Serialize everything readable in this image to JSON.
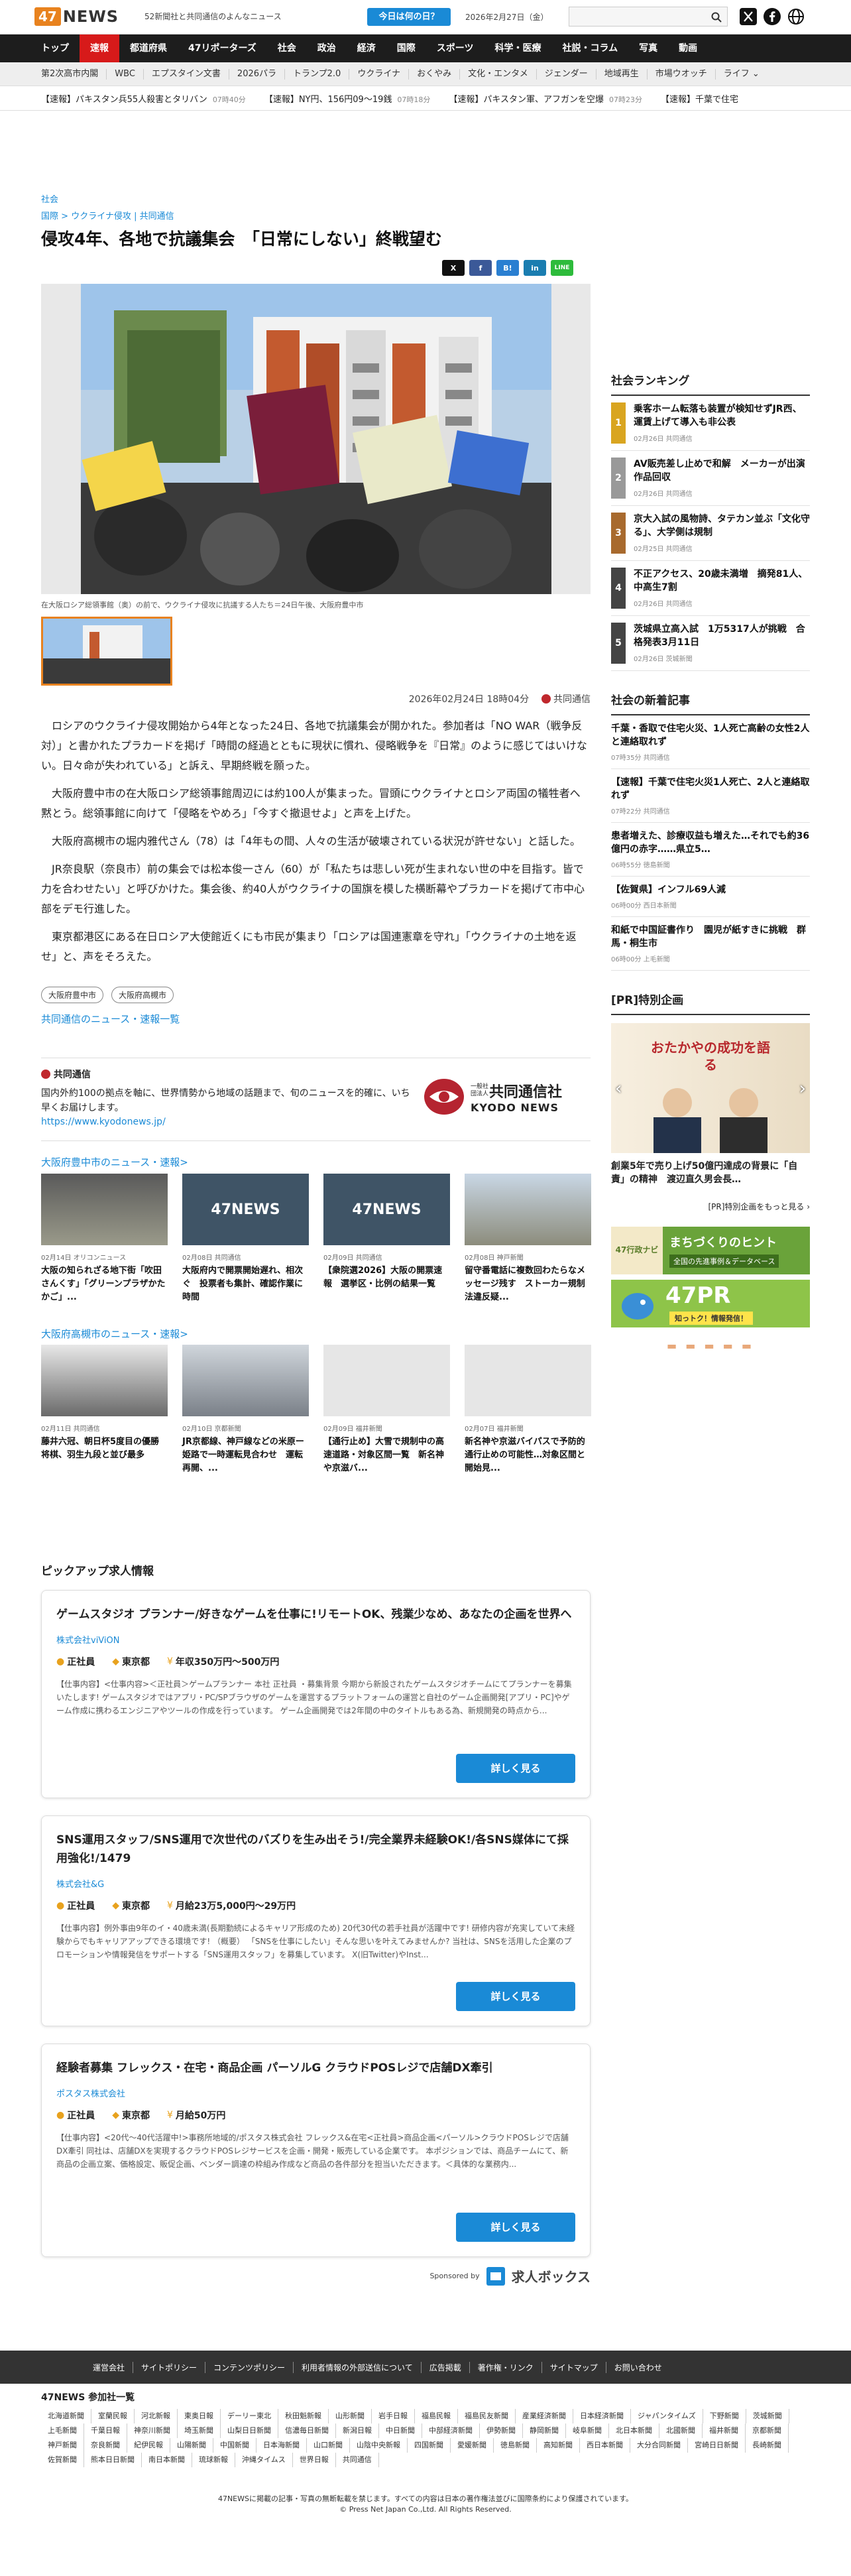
{
  "header": {
    "logo_num": "47",
    "logo_text": "NEWS",
    "tagline": "52新聞社と共同通信のよんなニュース",
    "today_button": "今日は何の日？",
    "date": "2026年2月27日（金）"
  },
  "nav": [
    "トップ",
    "速報",
    "都道府県",
    "47リポーターズ",
    "社会",
    "政治",
    "経済",
    "国際",
    "スポーツ",
    "科学・医療",
    "社説・コラム",
    "写真",
    "動画"
  ],
  "subnav": [
    "第2次高市内閣",
    "WBC",
    "エプスタイン文書",
    "2026パラ",
    "トランプ2.0",
    "ウクライナ",
    "おくやみ",
    "文化・エンタメ",
    "ジェンダー",
    "地域再生",
    "市場ウオッチ",
    "ライフ"
  ],
  "ticker": [
    {
      "text": "【速報】パキスタン兵55人殺害とタリバン",
      "time": "07時40分"
    },
    {
      "text": "【速報】NY円、156円09～19銭",
      "time": "07時18分"
    },
    {
      "text": "【速報】パキスタン軍、アフガンを空爆",
      "time": "07時23分"
    },
    {
      "text": "【速報】千葉で住宅",
      "time": ""
    }
  ],
  "article": {
    "category": "社会",
    "breadcrumb": [
      "国際",
      "ウクライナ侵攻",
      "共同通信"
    ],
    "headline": "侵攻4年、各地で抗議集会　「日常にしない」終戦望む",
    "caption": "在大阪ロシア総領事館（奥）の前で、ウクライナ侵攻に抗議する人たち＝24日午後、大阪府豊中市",
    "published": "2026年02月24日 18時04分",
    "source": "共同通信",
    "paragraphs": [
      "ロシアのウクライナ侵攻開始から4年となった24日、各地で抗議集会が開かれた。参加者は「NO WAR（戦争反対）」と書かれたプラカードを掲げ「時間の経過とともに現状に慣れ、侵略戦争を『日常』のように感じてはいけない。日々命が失われている」と訴え、早期終戦を願った。",
      "大阪府豊中市の在大阪ロシア総領事館周辺には約100人が集まった。冒頭にウクライナとロシア両国の犠牲者へ黙とう。総領事館に向けて「侵略をやめろ」「今すぐ撤退せよ」と声を上げた。",
      "大阪府高槻市の堀内雅代さん（78）は「4年もの間、人々の生活が破壊されている状況が許せない」と話した。",
      "JR奈良駅（奈良市）前の集会では松本俊一さん（60）が「私たちは悲しい死が生まれない世の中を目指す。皆で力を合わせたい」と呼びかけた。集会後、約40人がウクライナの国旗を模した横断幕やプラカードを掲げて市中心部をデモ行進した。",
      "東京都港区にある在日ロシア大使館近くにも市民が集まり「ロシアは国連憲章を守れ」「ウクライナの土地を返せ」と、声をそろえた。"
    ],
    "tags": [
      "大阪府豊中市",
      "大阪府高槻市"
    ],
    "more_link": "共同通信のニュース・速報一覧"
  },
  "share": [
    "X",
    "f",
    "B!",
    "in",
    "LINE"
  ],
  "kyodo": {
    "title": "共同通信",
    "description": "国内外約100の拠点を軸に、世界情勢から地域の話題まで、旬のニュースを的確に、いち早くお届けします。",
    "url": "https://www.kyodonews.jp/",
    "logo_sub": "一般社団法人",
    "logo_name": "共同通信社",
    "logo_en": "KYODO NEWS"
  },
  "toyonaka": {
    "title": "大阪府豊中市のニュース・速報>",
    "cards": [
      {
        "date": "02月14日",
        "source": "オリコンニュース",
        "title": "大阪の知られざる地下街「吹田さんくす」「グリーンプラザかたかご」..."
      },
      {
        "date": "02月08日",
        "source": "共同通信",
        "title": "大阪府内で開票開始遅れ、相次ぐ　投票者も集計、確認作業に時間"
      },
      {
        "date": "02月09日",
        "source": "共同通信",
        "title": "【衆院選2026】大阪の開票速報　選挙区・比例の結果一覧"
      },
      {
        "date": "02月08日",
        "source": "神戸新聞",
        "title": "留守番電話に複数回わたらなメッセージ残す　ストーカー規制法違反疑..."
      }
    ]
  },
  "takatsuki": {
    "title": "大阪府高槻市のニュース・速報>",
    "cards": [
      {
        "date": "02月11日",
        "source": "共同通信",
        "title": "藤井六冠、朝日杯5度目の優勝　将棋、羽生九段と並び最多"
      },
      {
        "date": "02月10日",
        "source": "京都新聞",
        "title": "JR京都線、神戸線などの米原ー姫路で一時運転見合わせ　運転再開、..."
      },
      {
        "date": "02月09日",
        "source": "福井新聞",
        "title": "【通行止め】大雪で規制中の高速道路・対象区間一覧　新名神や京滋バ..."
      },
      {
        "date": "02月07日",
        "source": "福井新聞",
        "title": "新名神や京滋バイパスで予防的通行止めの可能性…対象区間と開始見..."
      }
    ]
  },
  "pickup": {
    "title": "ピックアップ求人情報",
    "jobs": [
      {
        "title": "ゲームスタジオ プランナー/好きなゲームを仕事に!リモートOK、残業少なめ、あなたの企画を世界へ",
        "company": "株式会社viViON",
        "type": "正社員",
        "place": "東京都",
        "salary": "年収350万円～500万円",
        "desc": "【仕事内容】<仕事内容>＜正社員＞ゲームプランナー 本社 正社員 ・募集背景 今期から新設されたゲームスタジオチームにてプランナーを募集いたします! ゲームスタジオではアプリ・PC/SPブラウザのゲームを運営するプラットフォームの運営と自社のゲーム企画開発[アプリ・PC]やゲーム作成に携わるエンジニアやツールの作成を行っています。 ゲーム企画開発では2年間の中のタイトルもある為、新規開発の時点から..."
      },
      {
        "title": "SNS運用スタッフ/SNS運用で次世代のバズりを生み出そう!/完全業界未経験OK!/各SNS媒体にて採用強化!/1479",
        "company": "株式会社&G",
        "type": "正社員",
        "place": "東京都",
        "salary": "月給23万5,000円～29万円",
        "desc": "【仕事内容】例外事由9年のイ・40歳未満(長期勤続によるキャリア形成のため) 20代30代の若手社員が活躍中です! 研修内容が充実していて未経験からでもキャリアアップできる環境です! （概要） 「SNSを仕事にしたい」そんな思いを叶えてみませんか? 当社は、SNSを活用した企業のプロモーションや情報発信をサポートする「SNS運用スタッフ」を募集しています。 X(旧Twitter)やInst..."
      },
      {
        "title": "経験者募集 フレックス・在宅・商品企画 パーソルG クラウドPOSレジで店舗DX牽引",
        "company": "ポスタス株式会社",
        "type": "正社員",
        "place": "東京都",
        "salary": "月給50万円",
        "desc": "【仕事内容】<20代〜40代活躍中!>事務所地域的/ポスタス株式会社 フレックス&在宅<正社員>商品企画<パーソル>クラウドPOSレジで店舗DX牽引 同社は、店舗DXを実現するクラウドPOSレジサービスを企画・開発・販売している企業です。 本ポジションでは、商品チームにて、新商品の企画立案、価格設定、販促企画、ベンダー調達の枠組み作成など商品の各件部分を担当いただきます。＜具体的な業務内..."
      }
    ],
    "button": "詳しく見る",
    "sponsored": "Sponsored by",
    "sponsor_name": "求人ボックス"
  },
  "ranking": {
    "title": "社会ランキング",
    "items": [
      {
        "num": "1",
        "title": "乗客ホーム転落も装置が検知せずJR西、運賃上げて導入も非公表",
        "date": "02月26日",
        "source": "共同通信"
      },
      {
        "num": "2",
        "title": "AV販売差し止めで和解　メーカーが出演作品回収",
        "date": "02月26日",
        "source": "共同通信"
      },
      {
        "num": "3",
        "title": "京大入試の風物詩、タテカン並ぶ「文化守る」、大学側は規制",
        "date": "02月25日",
        "source": "共同通信"
      },
      {
        "num": "4",
        "title": "不正アクセス、20歳未満増　摘発81人、中高生7割",
        "date": "02月26日",
        "source": "共同通信"
      },
      {
        "num": "5",
        "title": "茨城県立高入試　1万5317人が挑戦　合格発表3月11日",
        "date": "02月26日",
        "source": "茨城新聞"
      }
    ]
  },
  "newest": {
    "title": "社会の新着記事",
    "items": [
      {
        "title": "千葉・香取で住宅火災、1人死亡高齢の女性2人と連絡取れず",
        "time": "07時35分",
        "source": "共同通信"
      },
      {
        "title": "【速報】千葉で住宅火災1人死亡、2人と連絡取れず",
        "time": "07時22分",
        "source": "共同通信"
      },
      {
        "title": "患者増えた、診療収益も増えた…それでも約36億円の赤字……県立5…",
        "time": "06時55分",
        "source": "徳島新聞"
      },
      {
        "title": "【佐賀県】インフル69人減",
        "time": "06時00分",
        "source": "西日本新聞"
      },
      {
        "title": "和紙で中国証書作り　園児が紙すきに挑戦　群馬・桐生市",
        "time": "06時00分",
        "source": "上毛新聞"
      }
    ]
  },
  "pr": {
    "title": "[PR]特別企画",
    "banner_text": "おたかやの成功を語る",
    "caption": "創業5年で売り上げ50億円達成の背景に「自責」の精神　渡辺直久男会長…",
    "more": "[PR]特別企画をもっと見る ›",
    "ad1_title": "まちづくりのヒント",
    "ad1_sub": "全国の先進事例＆データベース",
    "ad1_left": "47行政ナビ",
    "ad2_title": "47PR",
    "ad2_sub": "知っトク！情報発信！"
  },
  "footer": {
    "links": [
      "運営会社",
      "サイトポリシー",
      "コンテンツポリシー",
      "利用者情報の外部送信について",
      "広告掲載",
      "著作権・リンク",
      "サイトマップ",
      "お問い合わせ"
    ],
    "partners_title": "47NEWS 参加社一覧",
    "partners": [
      "北海道新聞",
      "室蘭民報",
      "河北新報",
      "東奥日報",
      "デーリー東北",
      "秋田魁新報",
      "山形新聞",
      "岩手日報",
      "福島民報",
      "福島民友新聞",
      "産業経済新聞",
      "日本経済新聞",
      "ジャパンタイムズ",
      "下野新聞",
      "茨城新聞",
      "上毛新聞",
      "千葉日報",
      "神奈川新聞",
      "埼玉新聞",
      "山梨日日新聞",
      "信濃毎日新聞",
      "新潟日報",
      "中日新聞",
      "中部経済新聞",
      "伊勢新聞",
      "静岡新聞",
      "岐阜新聞",
      "北日本新聞",
      "北國新聞",
      "福井新聞",
      "京都新聞",
      "神戸新聞",
      "奈良新聞",
      "紀伊民報",
      "山陽新聞",
      "中国新聞",
      "日本海新聞",
      "山口新聞",
      "山陰中央新報",
      "四国新聞",
      "愛媛新聞",
      "徳島新聞",
      "高知新聞",
      "西日本新聞",
      "大分合同新聞",
      "宮崎日日新聞",
      "長崎新聞",
      "佐賀新聞",
      "熊本日日新聞",
      "南日本新聞",
      "琉球新報",
      "沖縄タイムス",
      "世界日報",
      "共同通信"
    ],
    "copy1": "47NEWSに掲載の記事・写真の無断転載を禁じます。すべての内容は日本の著作権法並びに国際条約により保護されています。",
    "copy2": "© Press Net Japan Co.,Ltd. All Rights Reserved."
  },
  "colors": {
    "brand": "#e8821e",
    "accent": "#d71a1a",
    "link": "#1a8ad6"
  }
}
